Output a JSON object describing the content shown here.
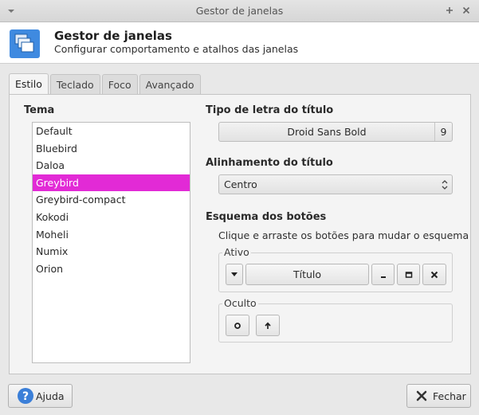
{
  "window": {
    "title": "Gestor de janelas",
    "menu_icon": "chevron-down-icon",
    "buttons": [
      "maximize-icon",
      "close-icon"
    ]
  },
  "header": {
    "title": "Gestor de janelas",
    "subtitle": "Configurar comportamento e atalhos das janelas",
    "icon": "window-manager-icon"
  },
  "tabs": [
    {
      "label": "Estilo",
      "active": true
    },
    {
      "label": "Teclado",
      "active": false
    },
    {
      "label": "Foco",
      "active": false
    },
    {
      "label": "Avançado",
      "active": false
    }
  ],
  "theme": {
    "label": "Tema",
    "items": [
      "Default",
      "Bluebird",
      "Daloa",
      "Greybird",
      "Greybird-compact",
      "Kokodi",
      "Moheli",
      "Numix",
      "Orion"
    ],
    "selected": "Greybird"
  },
  "title_font": {
    "label": "Tipo de letra do título",
    "name": "Droid Sans Bold",
    "size": "9"
  },
  "title_alignment": {
    "label": "Alinhamento do título",
    "value": "Centro"
  },
  "button_layout": {
    "label": "Esquema dos botões",
    "hint": "Clique e arraste os botões para mudar o esquema",
    "active_label": "Ativo",
    "title_button": "Título",
    "hidden_label": "Oculto"
  },
  "footer": {
    "help": "Ajuda",
    "close": "Fechar"
  },
  "colors": {
    "selection": "#e22ad6",
    "help_icon": "#3b7fd8"
  }
}
